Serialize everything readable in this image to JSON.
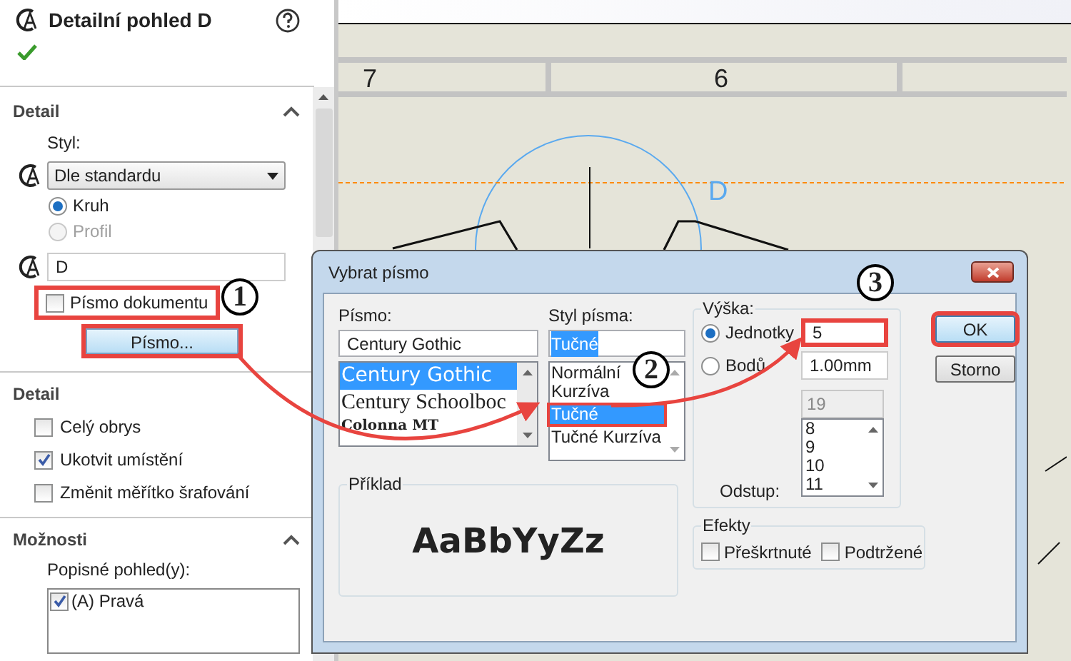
{
  "panel": {
    "title": "Detailní pohled D",
    "detail": {
      "title": "Detail",
      "style_label": "Styl:",
      "style_value": "Dle standardu",
      "radios": [
        {
          "label": "Kruh",
          "selected": true,
          "disabled": false
        },
        {
          "label": "Profil",
          "selected": false,
          "disabled": true
        }
      ],
      "label_value": "D",
      "document_font": {
        "label": "Písmo dokumentu",
        "checked": false,
        "highlighted": true
      },
      "font_button": {
        "label": "Písmo...",
        "highlighted": true
      }
    },
    "detail2": {
      "title": "Detail",
      "checkboxes": [
        {
          "label": "Celý obrys",
          "checked": false
        },
        {
          "label": "Ukotvit umístění",
          "checked": true
        },
        {
          "label": "Změnit měřítko šrafování",
          "checked": false
        }
      ]
    },
    "options": {
      "title": "Možnosti",
      "list_label": "Popisné pohled(y):",
      "items": [
        {
          "label": "(A) Pravá",
          "checked": true
        }
      ]
    }
  },
  "canvas": {
    "ruler_labels": [
      "7",
      "6"
    ],
    "view_label": "D"
  },
  "dialog": {
    "title": "Vybrat písmo",
    "font": {
      "label": "Písmo:",
      "value": "Century Gothic",
      "options": [
        {
          "label": "Century Gothic",
          "selected": true,
          "kind": "sans"
        },
        {
          "label": "Century Schoolboc",
          "selected": false,
          "kind": "serif"
        },
        {
          "label": "Colonna MT",
          "selected": false,
          "kind": "decorative"
        }
      ]
    },
    "style": {
      "label": "Styl písma:",
      "value": "Tučné",
      "options": [
        {
          "label": "Normální",
          "selected": false,
          "highlighted": false
        },
        {
          "label": "Kurzíva",
          "selected": false,
          "highlighted": false
        },
        {
          "label": "Tučné",
          "selected": true,
          "highlighted": true
        },
        {
          "label": "Tučné Kurzíva",
          "selected": false,
          "highlighted": false
        }
      ]
    },
    "height": {
      "label": "Výška:",
      "radios": [
        {
          "label": "Jednotky",
          "selected": true,
          "value": "5",
          "highlighted": true
        },
        {
          "label": "Bodů",
          "selected": false,
          "value": "1.00mm",
          "highlighted": false
        }
      ],
      "size_value": "19",
      "sizes": [
        "8",
        "9",
        "10",
        "11"
      ],
      "spacing_label": "Odstup:"
    },
    "buttons": [
      {
        "label": "OK",
        "highlighted": true
      },
      {
        "label": "Storno",
        "highlighted": false
      }
    ],
    "effects": {
      "label": "Efekty",
      "checkboxes": [
        {
          "label": "Přeškrtnuté",
          "checked": false
        },
        {
          "label": "Podtržené",
          "checked": false
        }
      ]
    },
    "sample": {
      "label": "Příklad",
      "text": "AaBbYyZz"
    }
  },
  "callouts": [
    "1",
    "2",
    "3"
  ]
}
